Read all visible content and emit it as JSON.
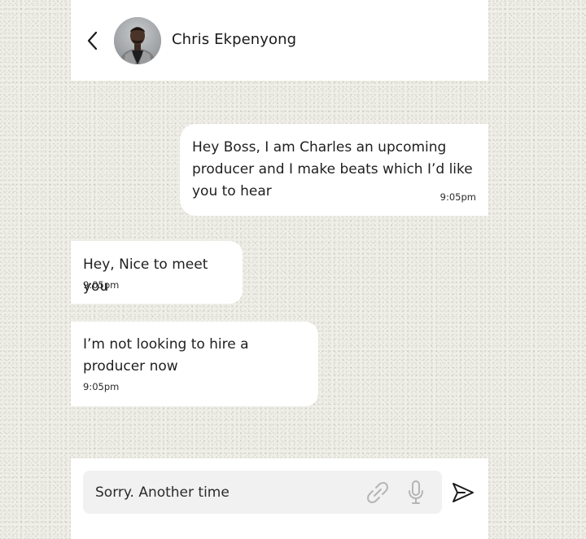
{
  "header": {
    "contact_name": "Chris Ekpenyong",
    "back_icon": "chevron-left-icon",
    "avatar": "contact-avatar-photo"
  },
  "messages": [
    {
      "direction": "outgoing",
      "text": "Hey Boss, I am Charles an upcoming producer and I make beats which I’d like you to hear",
      "time": "9:05pm"
    },
    {
      "direction": "incoming",
      "text": "Hey, Nice to meet you",
      "time": "9:05pm"
    },
    {
      "direction": "incoming",
      "text": "I’m not looking to hire a producer now",
      "time": "9:05pm"
    }
  ],
  "composer": {
    "value": "Sorry. Another time",
    "attach_icon": "paperclip-icon",
    "mic_icon": "microphone-icon",
    "send_icon": "send-icon"
  },
  "colors": {
    "background": "#efeee7",
    "surface": "#ffffff",
    "input_background": "#f1f1f1",
    "muted_icon": "#b5b5b5"
  }
}
